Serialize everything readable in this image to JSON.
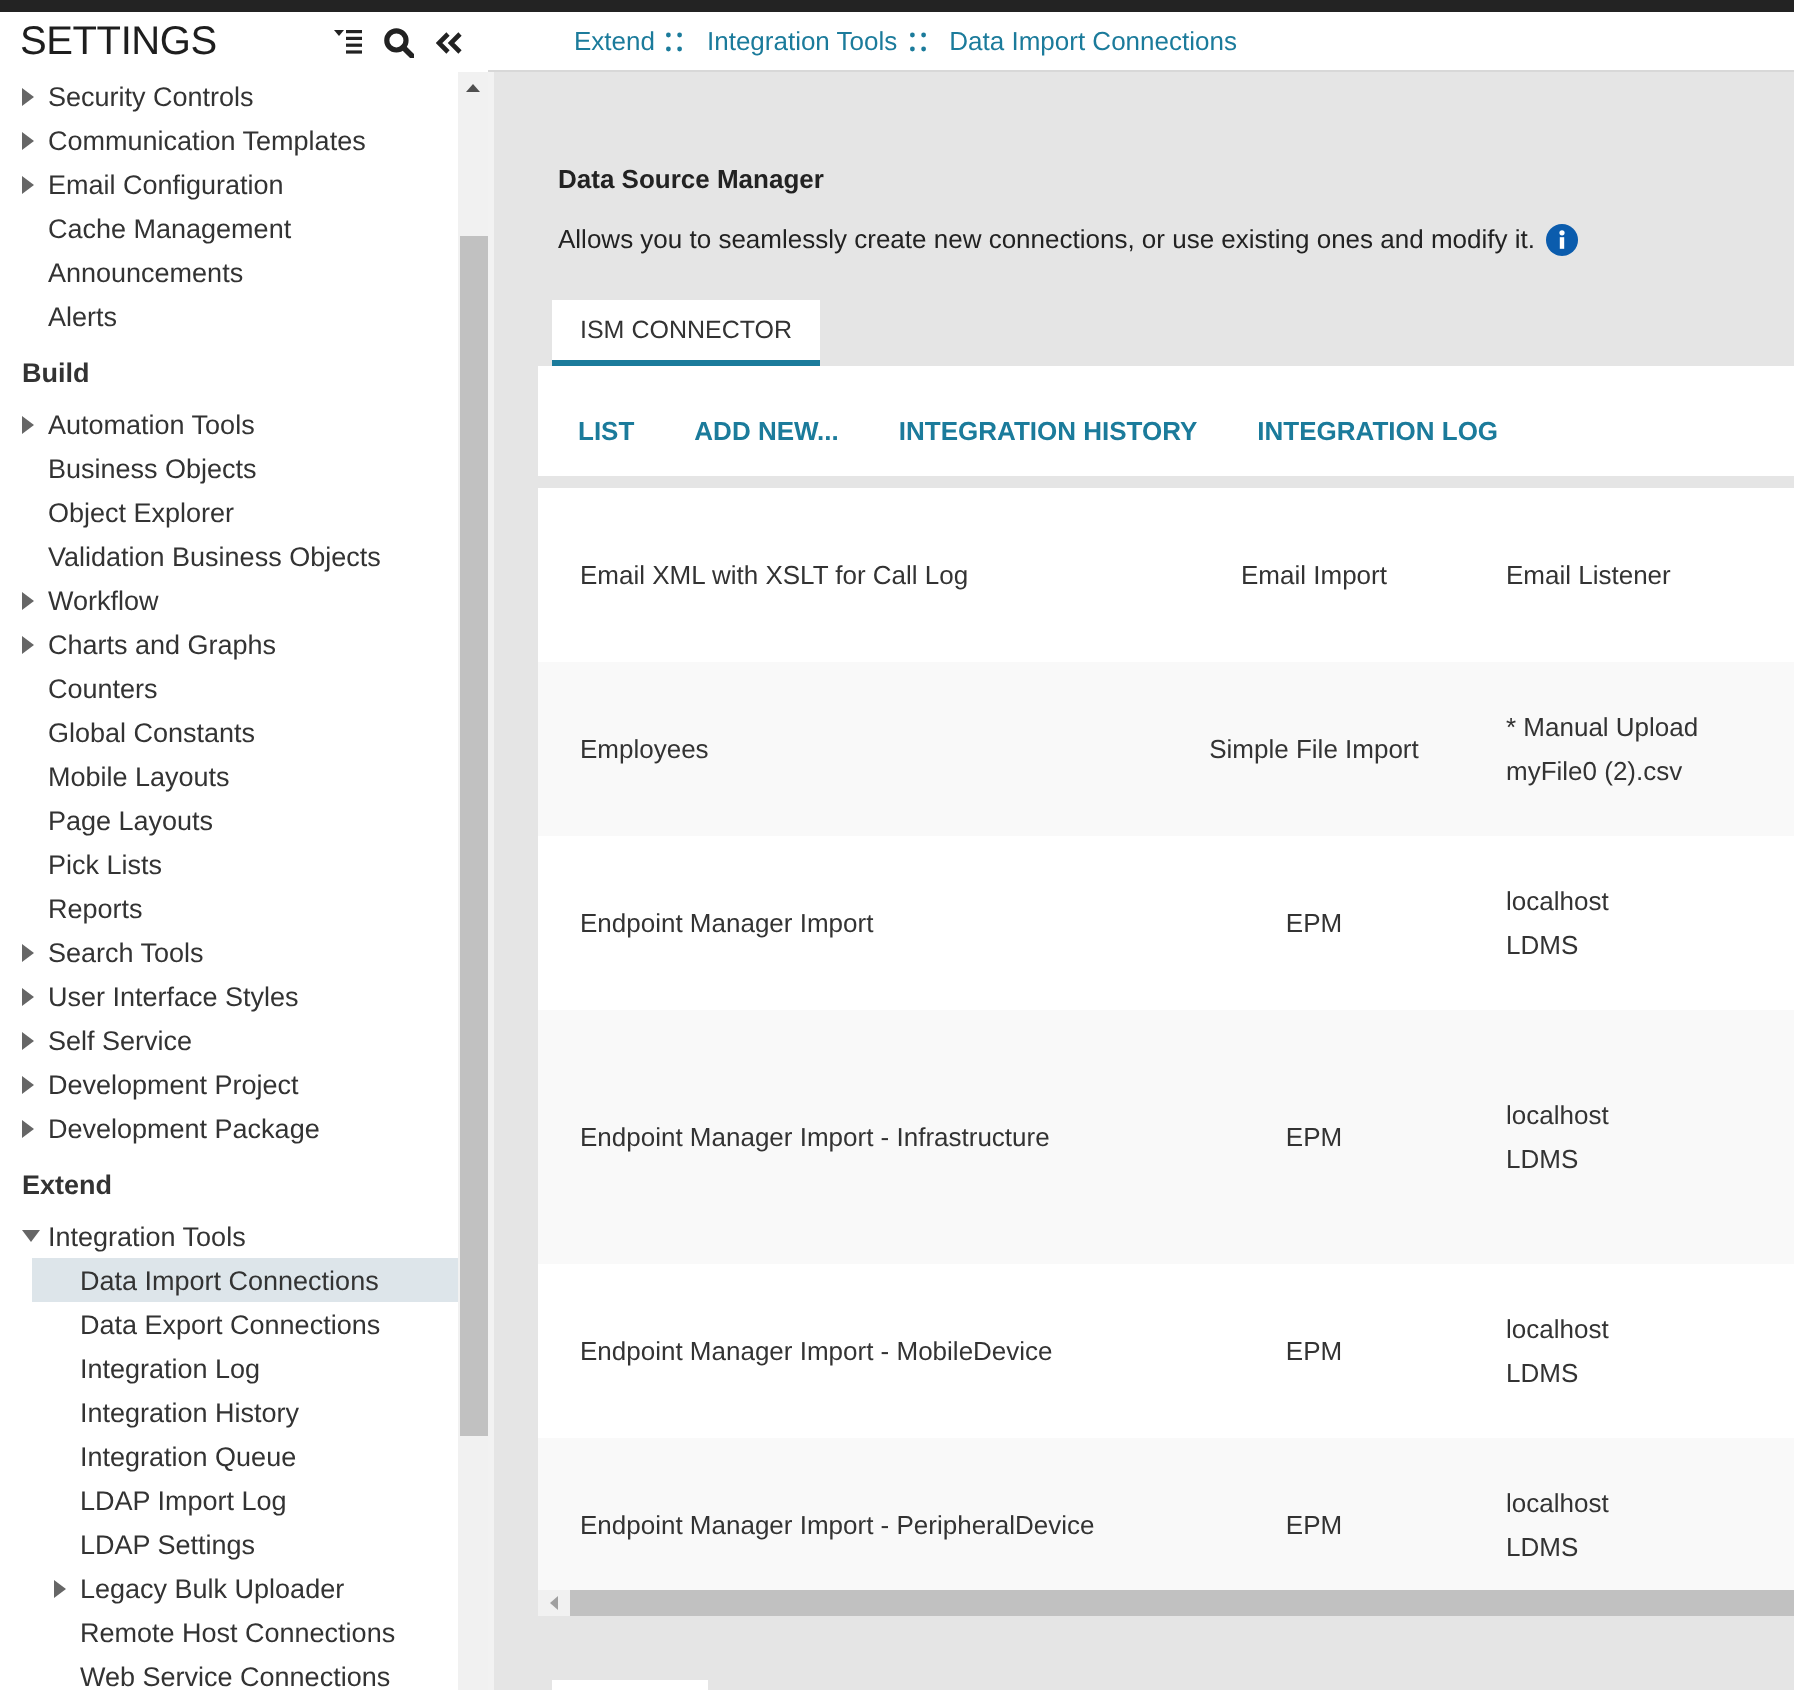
{
  "sidebar": {
    "title": "SETTINGS",
    "sections": [
      {
        "items": [
          {
            "label": "Security Controls",
            "kind": "group",
            "expanded": false,
            "selected": false
          },
          {
            "label": "Communication Templates",
            "kind": "group",
            "expanded": false,
            "selected": false
          },
          {
            "label": "Email Configuration",
            "kind": "group",
            "expanded": false,
            "selected": false
          },
          {
            "label": "Cache Management",
            "kind": "page",
            "selected": false
          },
          {
            "label": "Announcements",
            "kind": "page",
            "selected": false
          },
          {
            "label": "Alerts",
            "kind": "page",
            "selected": false
          }
        ]
      },
      {
        "heading": "Build",
        "items": [
          {
            "label": "Automation Tools",
            "kind": "group",
            "expanded": false,
            "selected": false
          },
          {
            "label": "Business Objects",
            "kind": "page",
            "selected": false
          },
          {
            "label": "Object Explorer",
            "kind": "page",
            "selected": false
          },
          {
            "label": "Validation Business Objects",
            "kind": "page",
            "selected": false
          },
          {
            "label": "Workflow",
            "kind": "group",
            "expanded": false,
            "selected": false
          },
          {
            "label": "Charts and Graphs",
            "kind": "group",
            "expanded": false,
            "selected": false
          },
          {
            "label": "Counters",
            "kind": "page",
            "selected": false
          },
          {
            "label": "Global Constants",
            "kind": "page",
            "selected": false
          },
          {
            "label": "Mobile Layouts",
            "kind": "page",
            "selected": false
          },
          {
            "label": "Page Layouts",
            "kind": "page",
            "selected": false
          },
          {
            "label": "Pick Lists",
            "kind": "page",
            "selected": false
          },
          {
            "label": "Reports",
            "kind": "page",
            "selected": false
          },
          {
            "label": "Search Tools",
            "kind": "group",
            "expanded": false,
            "selected": false
          },
          {
            "label": "User Interface Styles",
            "kind": "group",
            "expanded": false,
            "selected": false
          },
          {
            "label": "Self Service",
            "kind": "group",
            "expanded": false,
            "selected": false
          },
          {
            "label": "Development Project",
            "kind": "group",
            "expanded": false,
            "selected": false
          },
          {
            "label": "Development Package",
            "kind": "group",
            "expanded": false,
            "selected": false
          }
        ]
      },
      {
        "heading": "Extend",
        "items": [
          {
            "label": "Integration Tools",
            "kind": "group",
            "expanded": true,
            "selected": false,
            "children": [
              {
                "label": "Data Import Connections",
                "kind": "page",
                "selected": true
              },
              {
                "label": "Data Export Connections",
                "kind": "page",
                "selected": false
              },
              {
                "label": "Integration Log",
                "kind": "page",
                "selected": false
              },
              {
                "label": "Integration History",
                "kind": "page",
                "selected": false
              },
              {
                "label": "Integration Queue",
                "kind": "page",
                "selected": false
              },
              {
                "label": "LDAP Import Log",
                "kind": "page",
                "selected": false
              },
              {
                "label": "LDAP Settings",
                "kind": "page",
                "selected": false
              },
              {
                "label": "Legacy Bulk Uploader",
                "kind": "group",
                "expanded": false,
                "selected": false
              },
              {
                "label": "Remote Host Connections",
                "kind": "page",
                "selected": false
              },
              {
                "label": "Web Service Connections",
                "kind": "page",
                "selected": false
              }
            ]
          }
        ]
      }
    ]
  },
  "breadcrumb": [
    "Extend",
    "Integration Tools",
    "Data Import Connections"
  ],
  "header": {
    "title": "Data Source Manager",
    "description": "Allows you to seamlessly create new connections, or use existing ones and modify it."
  },
  "tabs": [
    {
      "label": "ISM CONNECTOR",
      "selected": true
    }
  ],
  "actions": [
    "LIST",
    "ADD NEW...",
    "INTEGRATION HISTORY",
    "INTEGRATION LOG"
  ],
  "table": {
    "rows": [
      {
        "column_1": "Email XML with XSLT for Call Log",
        "column_2": "Email Import",
        "column_3": [
          "Email Listener"
        ]
      },
      {
        "column_1": "Employees",
        "column_2": "Simple File Import",
        "column_3": [
          "* Manual Upload",
          "myFile0 (2).csv"
        ]
      },
      {
        "column_1": "Endpoint Manager Import",
        "column_2": "EPM",
        "column_3": [
          "localhost",
          "LDMS"
        ]
      },
      {
        "column_1": "Endpoint Manager Import - Infrastructure",
        "column_2": "EPM",
        "column_3": [
          "localhost",
          "LDMS"
        ]
      },
      {
        "column_1": "Endpoint Manager Import - MobileDevice",
        "column_2": "EPM",
        "column_3": [
          "localhost",
          "LDMS"
        ]
      },
      {
        "column_1": "Endpoint Manager Import - PeripheralDevice",
        "column_2": "EPM",
        "column_3": [
          "localhost",
          "LDMS"
        ]
      }
    ]
  }
}
